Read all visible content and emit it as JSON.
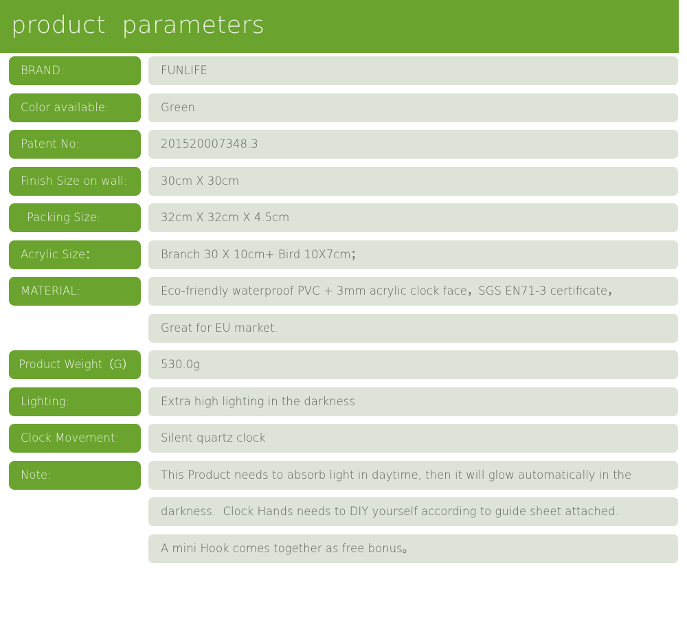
{
  "header": {
    "title": "product  parameters",
    "background_color": "#6aa32e",
    "text_color": "#eef5e6"
  },
  "theme": {
    "label_pill_color": "#6aa32e",
    "label_text_color": "#edf4e4",
    "value_pill_color": "#dde4d7",
    "value_text_color": "#595d58",
    "page_background": "#ffffff"
  },
  "rows": [
    {
      "label": "BRAND:",
      "value": "FUNLIFE"
    },
    {
      "label": "Color available:",
      "value": "Green"
    },
    {
      "label": "Patent No:",
      "value": "201520007348.3"
    },
    {
      "label": "Finish Size on wall:",
      "value": "30cm X 30cm"
    },
    {
      "label": "Packing Size:",
      "value": "32cm X 32cm X 4.5cm"
    },
    {
      "label": "Acrylic Size：",
      "value": "Branch 30 X 10cm+ Bird 10X7cm；"
    },
    {
      "label": "MATERIAL:",
      "value": "Eco-friendly waterproof PVC + 3mm acrylic clock face，SGS EN71-3 certificate，"
    },
    {
      "label": "",
      "value": "Great for EU market."
    },
    {
      "label": "Product Weight（G）",
      "value": "530.0g"
    },
    {
      "label": "Lighting:",
      "value": "Extra high lighting in the darkness"
    },
    {
      "label": "Clock Movement:",
      "value": "Silent quartz clock"
    },
    {
      "label": "Note:",
      "value": "This Product needs to absorb light in daytime, then it will glow automatically in the"
    },
    {
      "label": "",
      "value": "darkness.  Clock Hands needs to DIY yourself according to guide sheet attached."
    },
    {
      "label": "",
      "value": "A mini Hook comes together as free bonus。"
    }
  ]
}
